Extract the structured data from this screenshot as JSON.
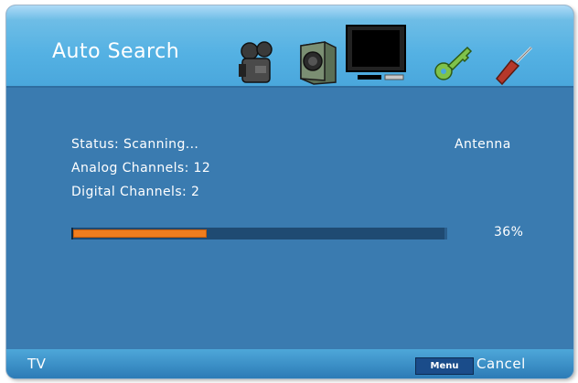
{
  "header": {
    "title": "Auto Search",
    "icons": [
      {
        "name": "camera-icon"
      },
      {
        "name": "speaker-icon"
      },
      {
        "name": "tv-icon",
        "selected": true
      },
      {
        "name": "key-icon"
      },
      {
        "name": "screwdriver-icon"
      }
    ]
  },
  "scan": {
    "status": "Status: Scanning...",
    "source": "Antenna",
    "analog": "Analog Channels: 12",
    "digital": "Digital Channels: 2",
    "progress_label": "36%",
    "progress_fraction": 0.36
  },
  "footer": {
    "left_label": "TV",
    "menu_key": "Menu",
    "cancel_label": "Cancel"
  },
  "colors": {
    "progress_fill": "#f07d1e",
    "panel": "#3a7bb0",
    "header": "#54b1e3"
  }
}
